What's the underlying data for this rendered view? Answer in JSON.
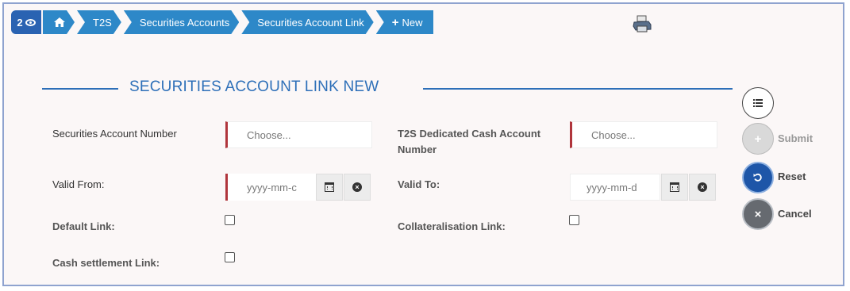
{
  "breadcrumb": {
    "counter": "2",
    "items": [
      "T2S",
      "Securities Accounts",
      "Securities Account Link"
    ],
    "new_label": "New"
  },
  "form": {
    "title": "SECURITIES ACCOUNT LINK NEW",
    "securities_account_number": {
      "label": "Securities Account Number",
      "placeholder": "Choose..."
    },
    "t2s_dedicated_cash_account": {
      "label_line1": "T2S Dedicated Cash Account",
      "label_line2": "Number",
      "placeholder": "Choose..."
    },
    "valid_from": {
      "label": "Valid From:",
      "placeholder": "yyyy-mm-c"
    },
    "valid_to": {
      "label": "Valid To:",
      "placeholder": "yyyy-mm-d"
    },
    "default_link": {
      "label": "Default Link:",
      "checked": false
    },
    "collateralisation_link": {
      "label": "Collateralisation Link:",
      "checked": false
    },
    "cash_settlement_link": {
      "label": "Cash settlement Link:",
      "checked": false
    }
  },
  "actions": {
    "submit_label": "Submit",
    "reset_label": "Reset",
    "cancel_label": "Cancel"
  },
  "icons": {
    "home": "home-icon",
    "eye": "eye-icon",
    "printer": "printer-icon",
    "calendar": "calendar-icon",
    "clear": "clear-icon",
    "list": "list-icon"
  },
  "colors": {
    "accent": "#2d6fb8",
    "breadcrumb": "#2d88c8",
    "required_marker": "#b0353c",
    "reset": "#1e56a8",
    "cancel": "#666a70"
  }
}
